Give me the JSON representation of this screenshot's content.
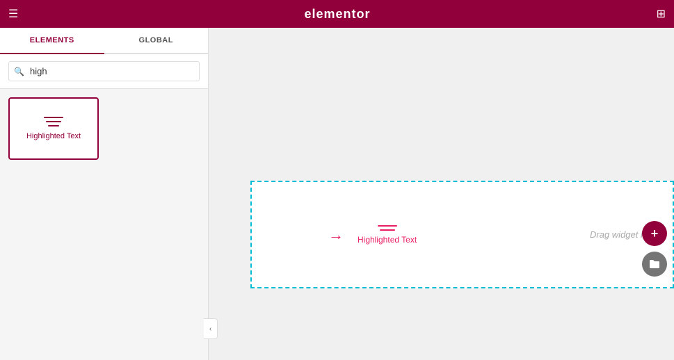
{
  "header": {
    "logo": "elementor",
    "hamburger_icon": "☰",
    "grid_icon": "⊞"
  },
  "sidebar": {
    "tabs": [
      {
        "id": "elements",
        "label": "ELEMENTS",
        "active": true
      },
      {
        "id": "global",
        "label": "GLOBAL",
        "active": false
      }
    ],
    "search": {
      "placeholder": "high",
      "value": "high"
    },
    "widgets": [
      {
        "id": "highlighted-text",
        "label": "Highlighted Text"
      }
    ]
  },
  "canvas": {
    "drop_widget_label": "Highlighted Text",
    "drag_hint": "Drag widget here",
    "add_button_label": "+",
    "folder_button_label": "⬤"
  },
  "collapse_icon": "‹"
}
